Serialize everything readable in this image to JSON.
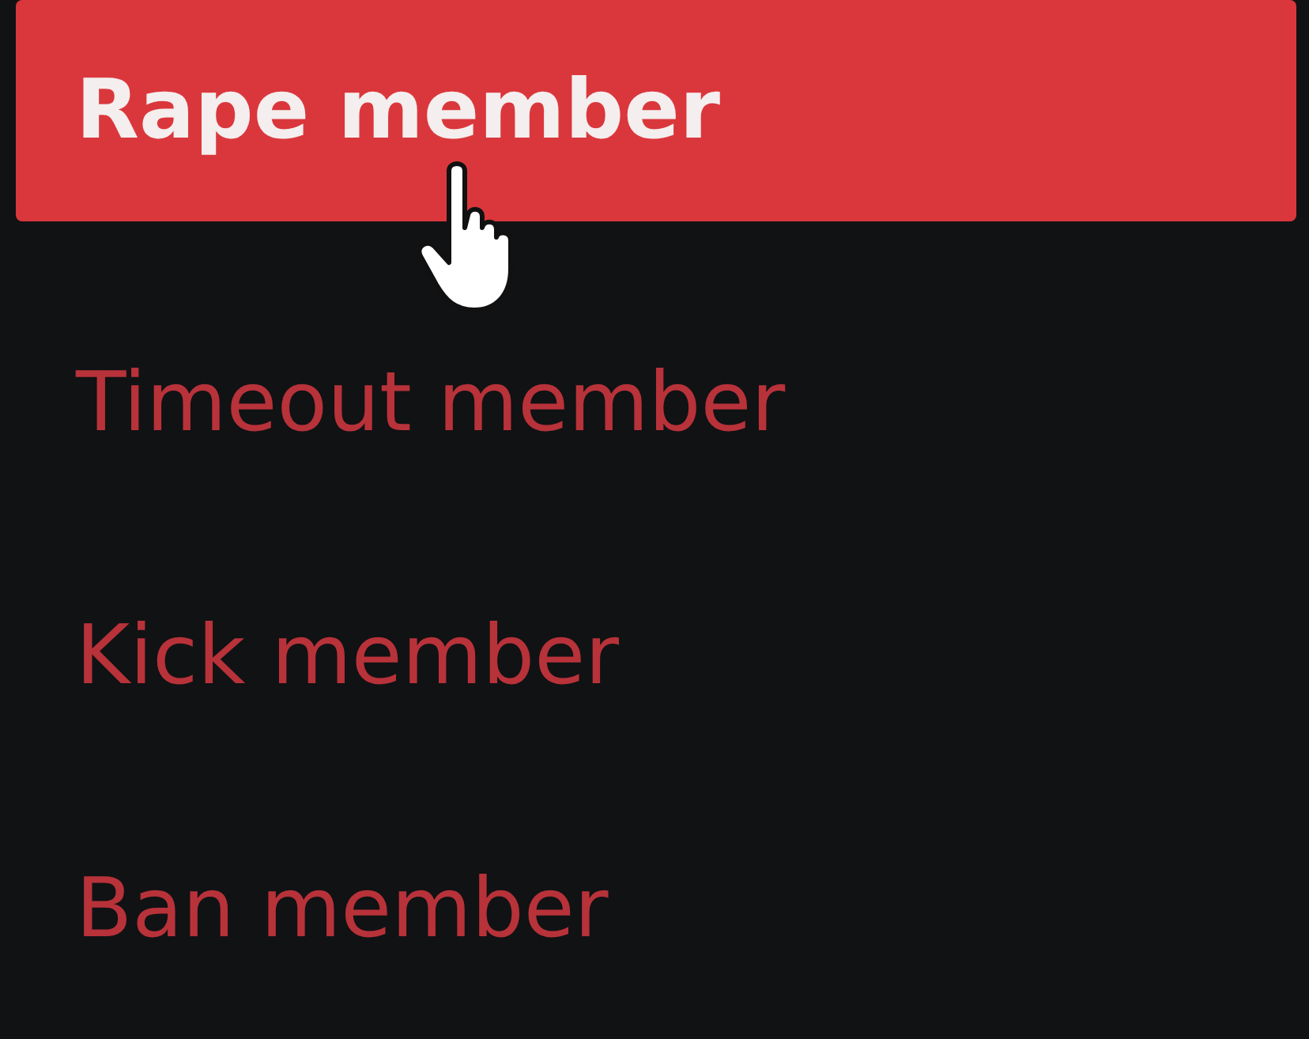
{
  "context_menu": {
    "items": [
      {
        "label": "Rape member",
        "selected": true
      },
      {
        "label": "Timeout member",
        "selected": false
      },
      {
        "label": "Kick member",
        "selected": false
      },
      {
        "label": "Ban member",
        "selected": false
      }
    ]
  }
}
